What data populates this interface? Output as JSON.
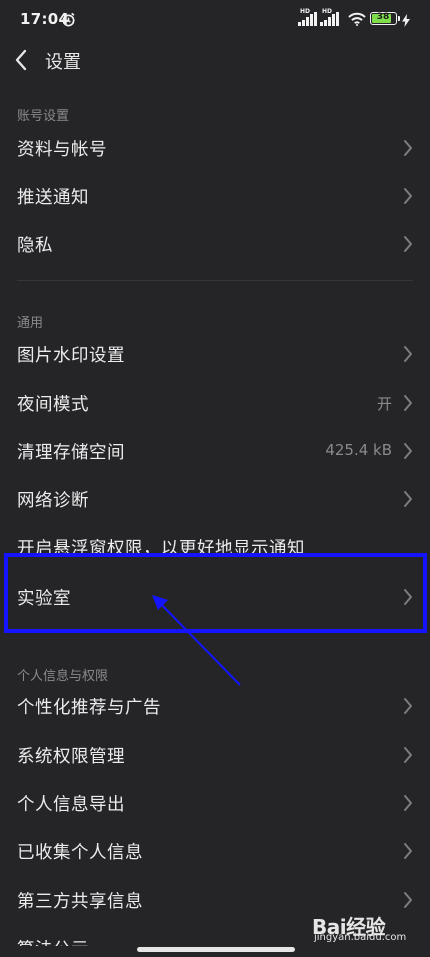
{
  "status_bar": {
    "time": "17:04",
    "hd_1": "HD",
    "hd_2": "HD",
    "battery": "38"
  },
  "header": {
    "title": "设置"
  },
  "sections": [
    {
      "label": "账号设置"
    },
    {
      "label": "通用"
    },
    {
      "label": "个人信息与权限"
    }
  ],
  "rows": [
    {
      "label": "资料与帐号"
    },
    {
      "label": "推送通知"
    },
    {
      "label": "隐私"
    },
    {
      "label": "图片水印设置"
    },
    {
      "label": "夜间模式",
      "value": "开"
    },
    {
      "label": "清理存储空间",
      "value": "425.4 kB"
    },
    {
      "label": "网络诊断"
    },
    {
      "label": "开启悬浮窗权限，以更好地显示通知"
    },
    {
      "label": "实验室"
    },
    {
      "label": "个性化推荐与广告"
    },
    {
      "label": "系统权限管理"
    },
    {
      "label": "个人信息导出"
    },
    {
      "label": "已收集个人信息"
    },
    {
      "label": "第三方共享信息"
    },
    {
      "label": "算法公示"
    }
  ],
  "watermark": {
    "logo": "Bai经验",
    "url": "jingyan.baidu.com"
  },
  "colors": {
    "background": "#252528",
    "annotation_blue": "#1414ff",
    "battery_green": "#7fdc4b"
  }
}
